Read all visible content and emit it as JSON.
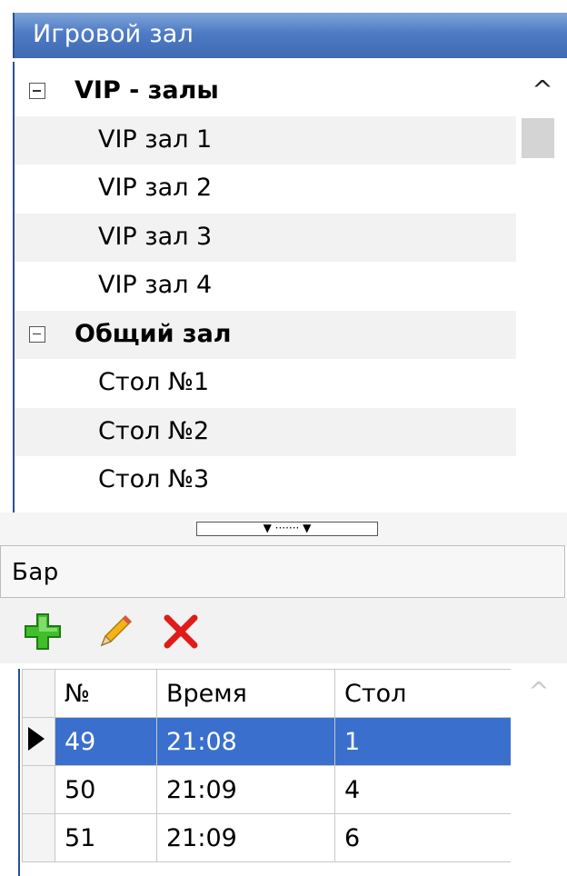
{
  "window": {
    "title": "Игровой зал"
  },
  "tree": {
    "groups": [
      {
        "label": "VIP - залы",
        "items": [
          "VIP зал 1",
          "VIP зал 2",
          "VIP зал 3",
          "VIP зал 4"
        ]
      },
      {
        "label": "Общий зал",
        "items": [
          "Стол №1",
          "Стол №2",
          "Стол №3"
        ]
      }
    ],
    "scroll_up_glyph": "^"
  },
  "splitter": {
    "grip_glyph": "▼ ······· ▼"
  },
  "bar": {
    "title": "Бар"
  },
  "toolbar": {
    "add_icon": "plus-icon",
    "edit_icon": "pencil-icon",
    "delete_icon": "x-icon",
    "colors": {
      "add": "#3fbf2a",
      "edit": "#f2b418",
      "delete": "#e01b1b"
    }
  },
  "grid": {
    "columns": [
      "№",
      "Время",
      "Стол"
    ],
    "rows": [
      {
        "num": "49",
        "time": "21:08",
        "table": "1",
        "selected": true
      },
      {
        "num": "50",
        "time": "21:09",
        "table": "4",
        "selected": false
      },
      {
        "num": "51",
        "time": "21:09",
        "table": "6",
        "selected": false
      }
    ],
    "scroll_up_glyph": "^",
    "selection_color": "#3a6fce"
  }
}
